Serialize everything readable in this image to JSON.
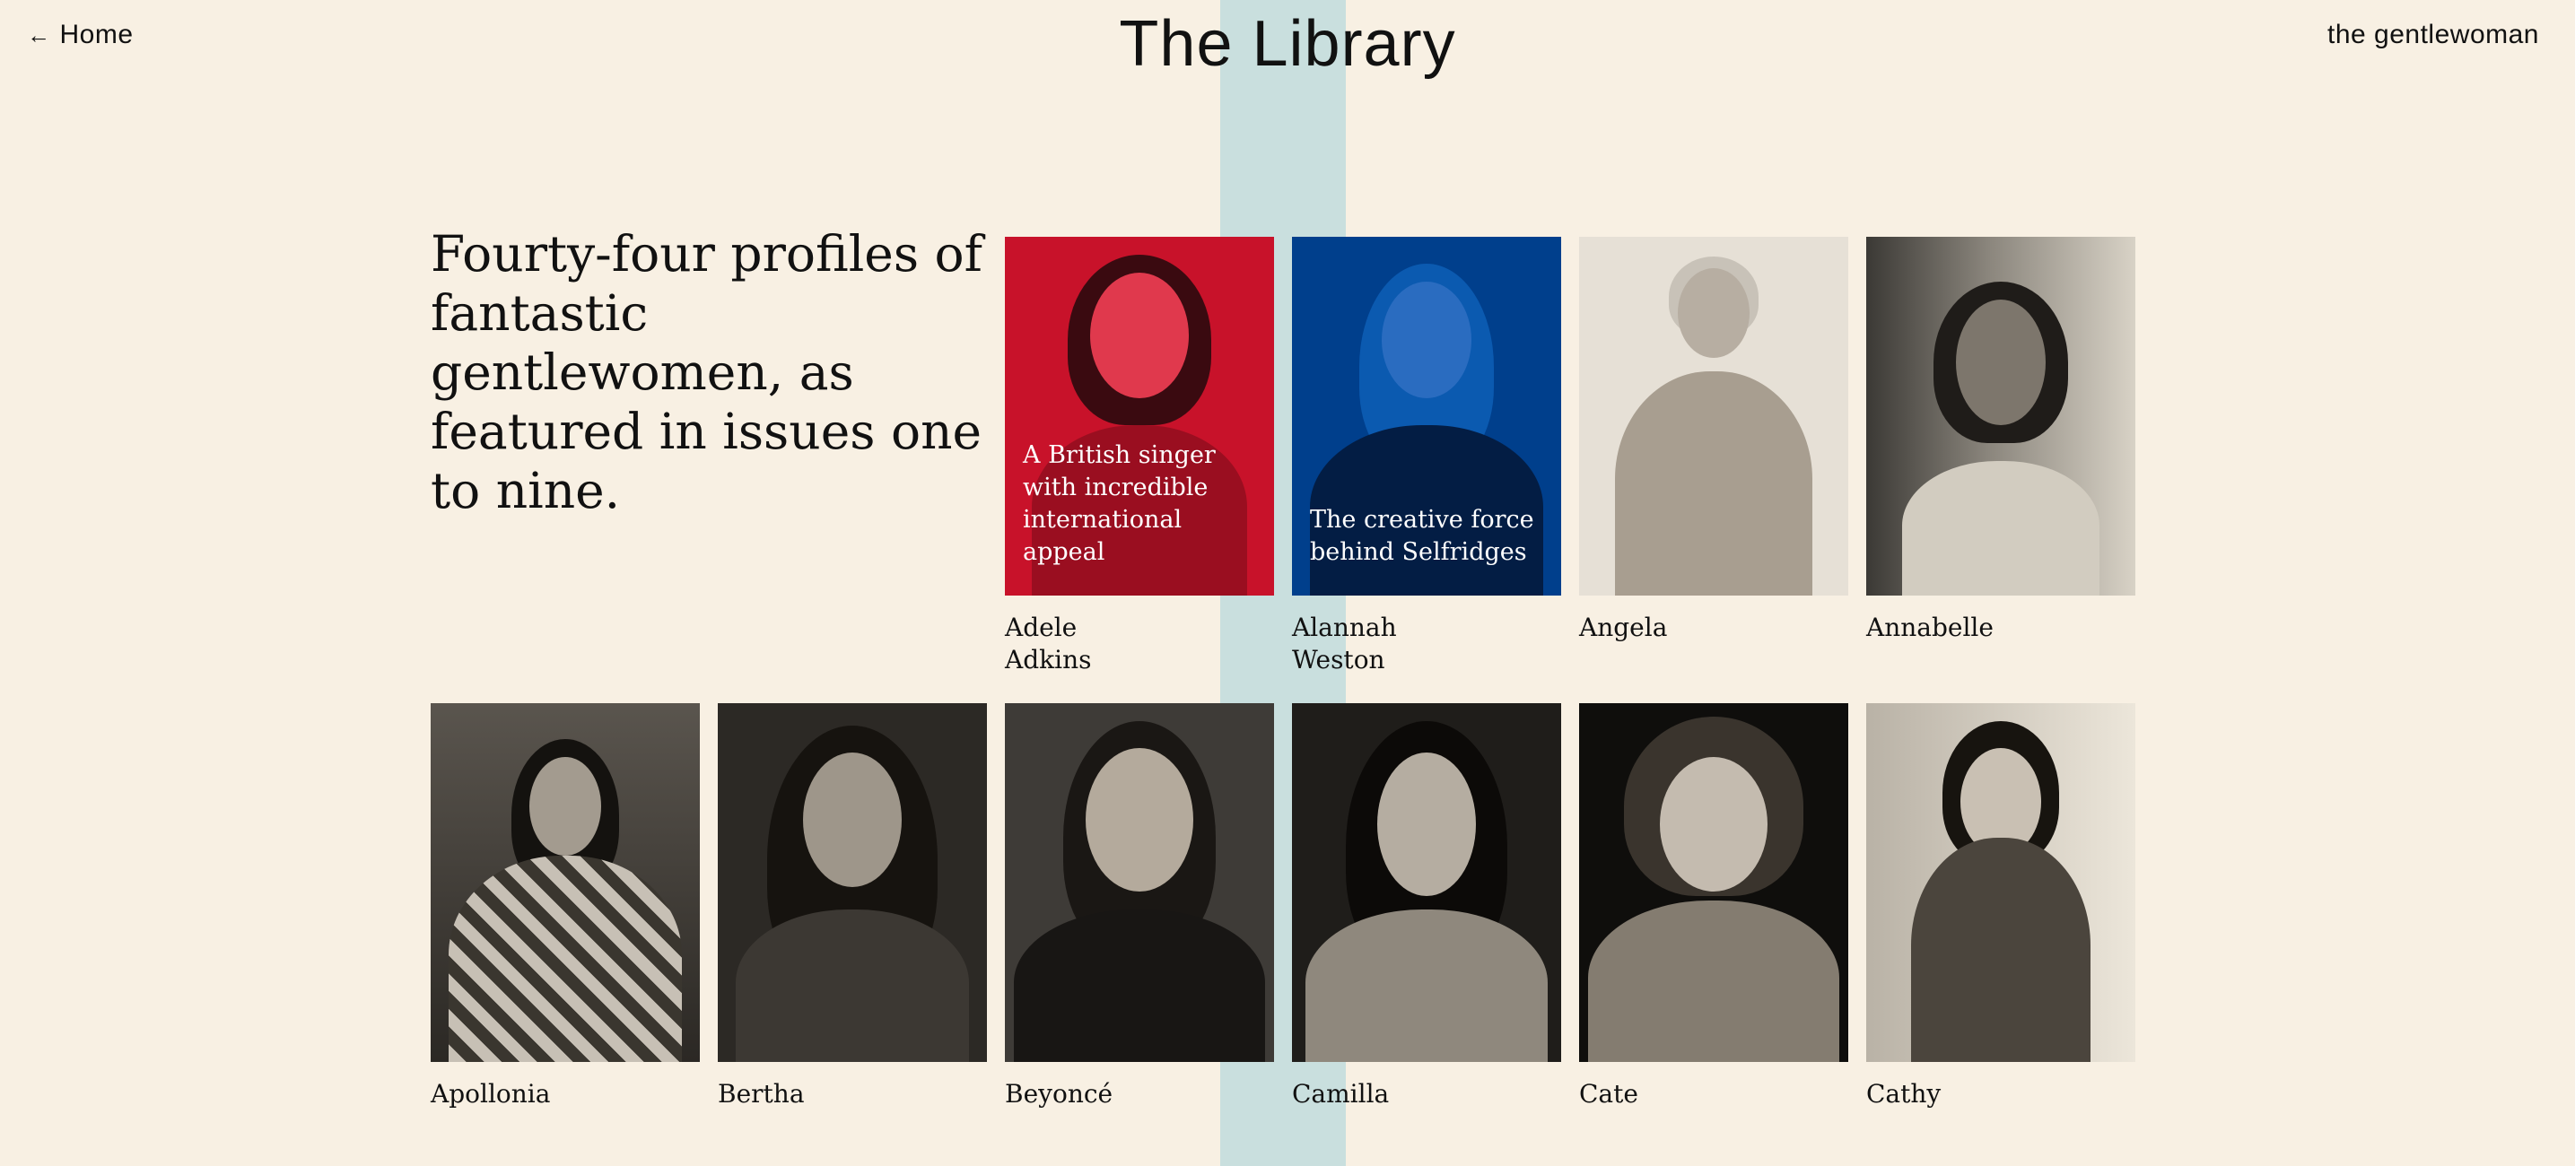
{
  "header": {
    "home_label": "Home",
    "title": "The Library",
    "brand": "the gentlewoman"
  },
  "intro": "Fourty-four profiles of fantastic gentlewomen, as featured in issues one to nine.",
  "colors": {
    "background": "#f8f0e3",
    "stripe": "#c9dfde",
    "adele_overlay": "#c8122a",
    "alannah_overlay": "#003f8c"
  },
  "profiles": [
    {
      "name": "Adele Adkins",
      "blurb": "A British singer with incredible international appeal"
    },
    {
      "name": "Alannah Weston",
      "blurb": "The creative force behind Selfridges"
    },
    {
      "name": "Angela"
    },
    {
      "name": "Annabelle"
    },
    {
      "name": "Apollonia"
    },
    {
      "name": "Bertha"
    },
    {
      "name": "Beyoncé"
    },
    {
      "name": "Camilla"
    },
    {
      "name": "Cate"
    },
    {
      "name": "Cathy"
    }
  ]
}
